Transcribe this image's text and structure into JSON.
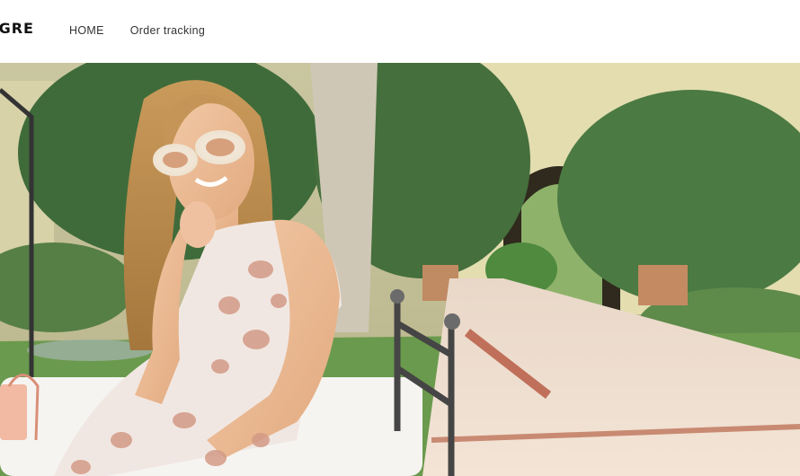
{
  "header": {
    "logo_text": "OGRE",
    "nav": [
      {
        "label": "HOME"
      },
      {
        "label": "Order tracking"
      }
    ]
  },
  "hero": {
    "image": "hero-photo"
  },
  "colors": {
    "header_bg": "#ffffff",
    "nav_text": "#333333",
    "logo_text": "#111111"
  }
}
